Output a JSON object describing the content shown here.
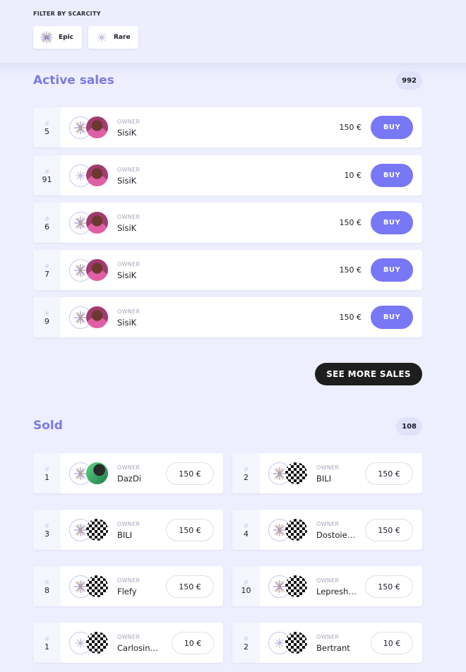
{
  "filter": {
    "title": "FILTER BY SCARCITY",
    "options": [
      {
        "label": "Epic",
        "icon": "epic-star-icon"
      },
      {
        "label": "Rare",
        "icon": "rare-star-icon"
      }
    ]
  },
  "active_sales": {
    "title": "Active sales",
    "count": "992",
    "hash": "#",
    "owner_label": "OWNER",
    "buy_label": "BUY",
    "rows": [
      {
        "number": "5",
        "owner": "SisiK",
        "price": "150 €"
      },
      {
        "number": "91",
        "owner": "SisiK",
        "price": "10 €"
      },
      {
        "number": "6",
        "owner": "SisiK",
        "price": "150 €"
      },
      {
        "number": "7",
        "owner": "SisiK",
        "price": "150 €"
      },
      {
        "number": "9",
        "owner": "SisiK",
        "price": "150 €"
      }
    ],
    "see_more_label": "SEE MORE SALES"
  },
  "sold": {
    "title": "Sold",
    "count": "108",
    "hash": "#",
    "owner_label": "OWNER",
    "items": [
      {
        "number": "1",
        "owner": "DazDi",
        "price": "150 €"
      },
      {
        "number": "2",
        "owner": "BILI",
        "price": "150 €"
      },
      {
        "number": "3",
        "owner": "BILI",
        "price": "150 €"
      },
      {
        "number": "4",
        "owner": "Dostoie…",
        "price": "150 €"
      },
      {
        "number": "8",
        "owner": "Flefy",
        "price": "150 €"
      },
      {
        "number": "10",
        "owner": "Lepresh…",
        "price": "150 €"
      },
      {
        "number": "1",
        "owner": "Carlosinn…",
        "price": "10 €"
      },
      {
        "number": "2",
        "owner": "Bertrant",
        "price": "10 €"
      }
    ]
  },
  "colors": {
    "accent": "#7877f5",
    "title": "#7b7ae6",
    "background": "#eeeffe",
    "see_more_bg": "#1e1e1e"
  }
}
